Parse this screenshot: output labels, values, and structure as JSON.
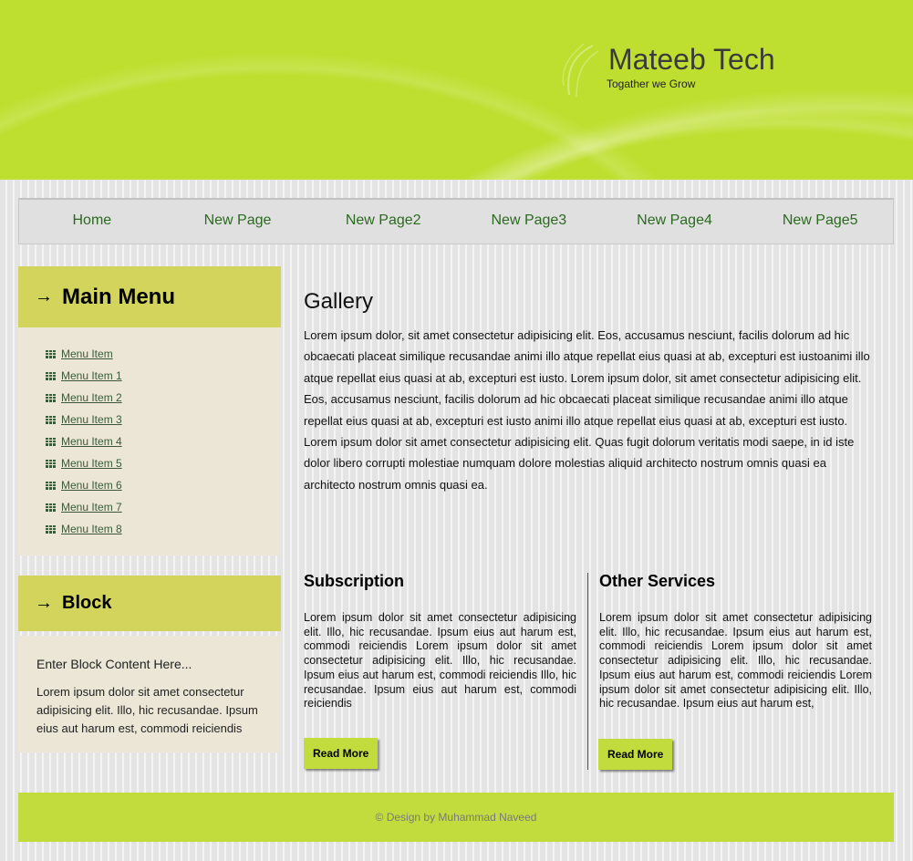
{
  "header": {
    "title": "Mateeb Tech",
    "slogan": "Togather we Grow"
  },
  "nav": {
    "items": [
      "Home",
      "New Page",
      "New Page2",
      "New Page3",
      "New Page4",
      "New Page5"
    ]
  },
  "sidebar": {
    "menu": {
      "title": "Main Menu",
      "arrow_icon": "arrow-right-icon",
      "item_icon": "table-grid-icon",
      "items": [
        "Menu Item",
        "Menu Item 1",
        "Menu Item 2",
        "Menu Item 3",
        "Menu Item 4",
        "Menu Item 5",
        "Menu Item 6",
        "Menu Item 7",
        "Menu Item 8"
      ]
    },
    "block": {
      "title": "Block",
      "intro": "Enter Block Content Here...",
      "text": "Lorem ipsum dolor sit amet consectetur adipisicing elit. Illo, hic recusandae. Ipsum eius aut harum est, commodi reiciendis"
    }
  },
  "main": {
    "gallery": {
      "title": "Gallery",
      "text": "Lorem ipsum dolor, sit amet consectetur adipisicing elit. Eos, accusamus nesciunt, facilis dolorum ad hic obcaecati placeat similique recusandae animi illo atque repellat eius quasi at ab, excepturi est iustoanimi illo atque repellat eius quasi at ab, excepturi est iusto. Lorem ipsum dolor, sit amet consectetur adipisicing elit. Eos, accusamus nesciunt, facilis dolorum ad hic obcaecati placeat similique recusandae animi illo atque repellat eius quasi at ab, excepturi est iusto animi illo atque repellat eius quasi at ab, excepturi est iusto. Lorem ipsum dolor sit amet consectetur adipisicing elit. Quas fugit dolorum veritatis modi saepe, in id iste dolor libero corrupti molestiae numquam dolore molestias aliquid architecto nostrum omnis quasi ea architecto nostrum omnis quasi ea."
    },
    "subscription": {
      "title": "Subscription",
      "text": "Lorem ipsum dolor sit amet consectetur adipisicing elit. Illo, hic recusandae. Ipsum eius aut harum est, commodi reiciendis Lorem ipsum dolor sit amet consectetur adipisicing elit. Illo, hic recusandae. Ipsum eius aut harum est, commodi reiciendis Illo, hic recusandae. Ipsum eius aut harum est, commodi reiciendis",
      "button": "Read More"
    },
    "services": {
      "title": "Other Services",
      "text": "Lorem ipsum dolor sit amet consectetur adipisicing elit. Illo, hic recusandae. Ipsum eius aut harum est, commodi reiciendis Lorem ipsum dolor sit amet consectetur adipisicing elit. Illo, hic recusandae. Ipsum eius aut harum est, commodi reiciendis Lorem ipsum dolor sit amet consectetur adipisicing elit. Illo, hic recusandae. Ipsum eius aut harum est,",
      "button": "Read More"
    }
  },
  "footer": {
    "text": "© Design by Muhammad Naveed"
  },
  "colors": {
    "header_green": "#bedf30",
    "panel_olive": "#d3d45c",
    "panel_body": "#ebe6d6",
    "nav_link": "#2a6a1f",
    "button_green": "#c2dc3e"
  }
}
